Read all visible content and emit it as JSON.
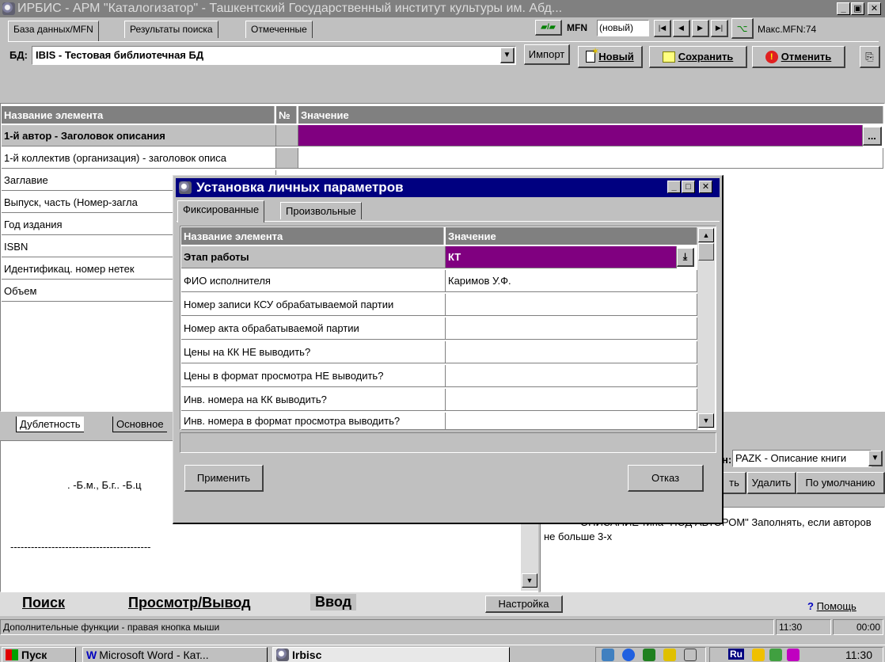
{
  "window": {
    "title": "ИРБИС - АРМ \"Каталогизатор\" - Ташкентский Государственный институт культуры им. Абд...",
    "min": "_",
    "max": "▣",
    "close": "✕"
  },
  "top_tabs": [
    "База данных/MFN",
    "Результаты поиска",
    "Отмеченные"
  ],
  "mfn": {
    "label": "MFN",
    "value": "(новый)",
    "max_mfn": "Макс.MFN:74",
    "nav_first": "|◀",
    "nav_prev": "◀",
    "nav_next": "▶",
    "nav_last": "▶|"
  },
  "db": {
    "label": "БД:",
    "value": "IBIS - Тестовая библиотечная БД",
    "import_button": "Импорт"
  },
  "toolbar": {
    "new_label": "Новый",
    "save_label": "Сохранить",
    "cancel_label": "Отменить"
  },
  "main_grid": {
    "header_name": "Название элемента",
    "header_no": "№",
    "header_value": "Значение",
    "rows": [
      "1-й автор - Заголовок описания",
      "1-й коллектив (организация) - заголовок описа",
      "Заглавие",
      "Выпуск, часть (Номер-загла",
      "Год издания",
      "ISBN",
      "Идентификац. номер нетек",
      "Объем"
    ],
    "ellipsis_button": "..."
  },
  "lower_tabs": [
    "Дублетность",
    "Основное"
  ],
  "preview": {
    "text": ". -Б.м., Б.г.. -Б.ц",
    "dashes": "-----------------------------------------"
  },
  "right_panel": {
    "format_label": "Формат:",
    "format_value": "PAZK - Описание книги",
    "btn_create": "ть",
    "btn_delete": "Удалить",
    "btn_default": "По умолчанию",
    "description": "ОПИСАНИЕ типа \"ПОД АВТОРОМ\"     Заполнять, если авторов не больше 3-х"
  },
  "dialog": {
    "title": "Установка личных параметров",
    "tabs": [
      "Фиксированные",
      "Произвольные"
    ],
    "header_name": "Название элемента",
    "header_value": "Значение",
    "rows": [
      {
        "name": "Этап работы",
        "value": "КТ"
      },
      {
        "name": "ФИО исполнителя",
        "value": "Каримов У.Ф."
      },
      {
        "name": "Номер записи КСУ обрабатываемой партии",
        "value": ""
      },
      {
        "name": "Номер акта обрабатываемой партии",
        "value": ""
      },
      {
        "name": "Цены на КК НЕ выводить?",
        "value": ""
      },
      {
        "name": "Цены в формат просмотра НЕ выводить?",
        "value": ""
      },
      {
        "name": "Инв. номера на КК выводить?",
        "value": ""
      },
      {
        "name": "Инв. номера в формат просмотра выводить?",
        "value": ""
      }
    ],
    "apply_button": "Применить",
    "cancel_button": "Отказ"
  },
  "bottom_tabs": {
    "search": "Поиск",
    "view": "Просмотр/Вывод",
    "input": "Ввод",
    "settings_button": "Настройка",
    "help": "Помощь"
  },
  "status": {
    "text": "Дополнительные функции - правая кнопка мыши",
    "time1": "11:30",
    "time2": "00:00"
  },
  "taskbar": {
    "start": "Пуск",
    "word": "Microsoft Word - Кат...",
    "irbis": "Irbisc",
    "clock": "11:30",
    "lang": "Ru"
  },
  "colors": {
    "selection": "#800080",
    "title_active": "#000080",
    "title_inactive": "#808080",
    "face": "#c0c0c0"
  }
}
